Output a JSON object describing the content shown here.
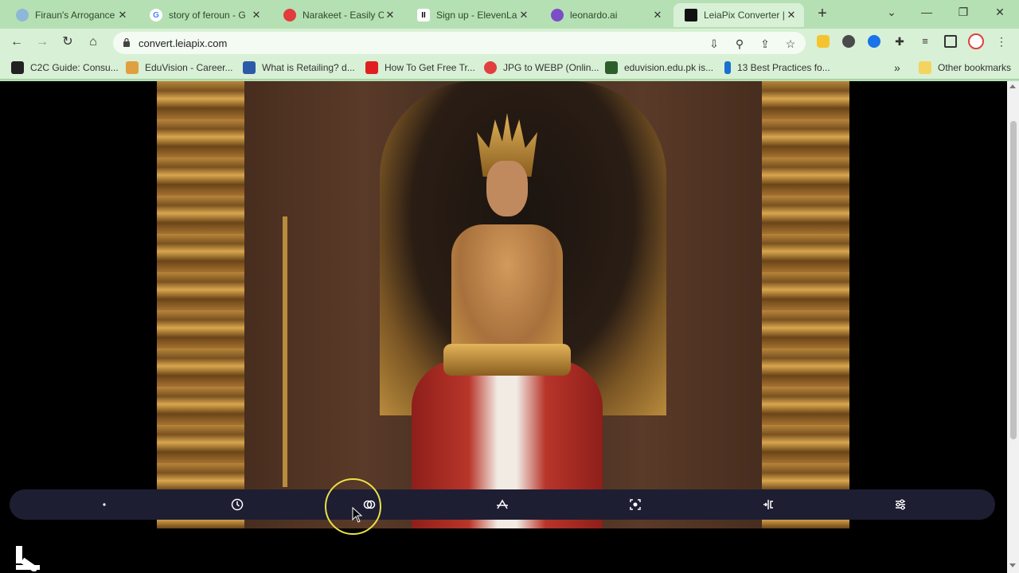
{
  "browser": {
    "tabs": [
      {
        "title": "Firaun's Arrogance",
        "favicon_color": "#8fb7d8",
        "active": false
      },
      {
        "title": "story of feroun - G",
        "favicon_color": "#ffffff",
        "active": false
      },
      {
        "title": "Narakeet - Easily C",
        "favicon_color": "#e23c3c",
        "active": false
      },
      {
        "title": "Sign up - ElevenLa",
        "favicon_color": "#ffffff",
        "active": false
      },
      {
        "title": "leonardo.ai",
        "favicon_color": "#7b4dc9",
        "active": false
      },
      {
        "title": "LeiaPix Converter |",
        "favicon_color": "#111111",
        "active": true
      }
    ],
    "new_tab_glyph": "+",
    "url": "convert.leiapix.com",
    "bookmarks": [
      {
        "label": "C2C Guide: Consu...",
        "icon_color": "#222222"
      },
      {
        "label": "EduVision - Career...",
        "icon_color": "#e0a040"
      },
      {
        "label": "What is Retailing? d...",
        "icon_color": "#2a5aa8"
      },
      {
        "label": "How To Get Free Tr...",
        "icon_color": "#e02020"
      },
      {
        "label": "JPG to WEBP (Onlin...",
        "icon_color": "#e04040"
      },
      {
        "label": "eduvision.edu.pk is...",
        "icon_color": "#2b5e2b"
      },
      {
        "label": "13 Best Practices fo...",
        "icon_color": "#1a6fd0"
      }
    ],
    "bookmarks_overflow": "»",
    "other_bookmarks": "Other bookmarks",
    "accent_color": "#b5e0b3"
  },
  "viewer": {
    "controls": [
      {
        "name": "dot-icon"
      },
      {
        "name": "clock-icon"
      },
      {
        "name": "link-rings-icon"
      },
      {
        "name": "animation-path-icon"
      },
      {
        "name": "focus-frame-icon"
      },
      {
        "name": "depth-split-icon"
      },
      {
        "name": "sliders-icon"
      }
    ],
    "bar_color": "#1e1e33",
    "cursor_highlight_color": "#e8e24a"
  }
}
